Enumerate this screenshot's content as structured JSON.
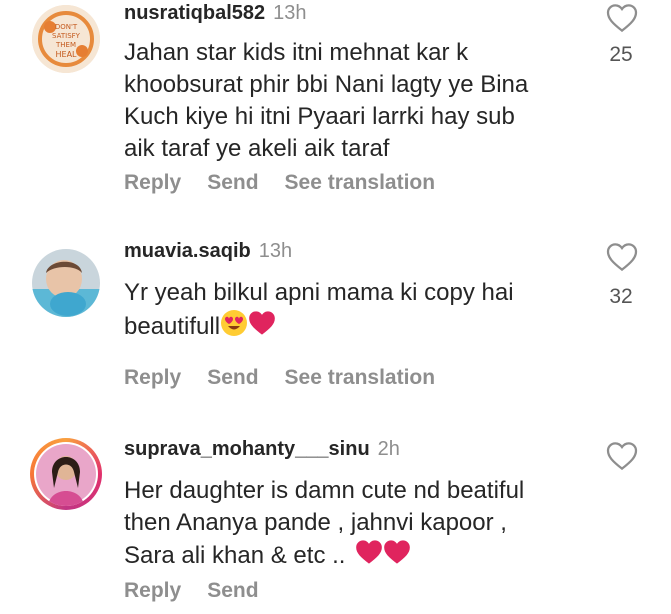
{
  "comments": [
    {
      "username": "nusratiqbal582",
      "time": "13h",
      "lines": [
        "Jahan star kids itni mehnat kar k",
        "khoobsurat phir bbi Nani lagty ye Bina",
        "Kuch kiye hi itni Pyaari larrki hay sub",
        "aik taraf ye akeli aik taraf"
      ],
      "actions": [
        "Reply",
        "Send",
        "See translation"
      ],
      "likes": "25",
      "avatar_text": [
        "DON'T",
        "SATISFY",
        "THEM",
        "HEAL"
      ]
    },
    {
      "username": "muavia.saqib",
      "time": "13h",
      "lines": [
        "Yr yeah bilkul apni mama ki copy hai",
        "beautifull"
      ],
      "actions": [
        "Reply",
        "Send",
        "See translation"
      ],
      "likes": "32"
    },
    {
      "username": "suprava_mohanty___sinu",
      "time": "2h",
      "lines": [
        "Her daughter is damn cute nd beatiful",
        "then Ananya pande , jahnvi kapoor ,",
        "Sara ali khan & etc .."
      ],
      "actions": [
        "Reply",
        "Send"
      ],
      "likes": ""
    }
  ],
  "icons": {
    "like": "heart-outline-icon",
    "heart_eyes": "heart-eyes-emoji",
    "red_heart": "red-heart-emoji"
  },
  "colors": {
    "text": "#262626",
    "muted": "#8e8e8e",
    "heart": "#e0245e"
  }
}
